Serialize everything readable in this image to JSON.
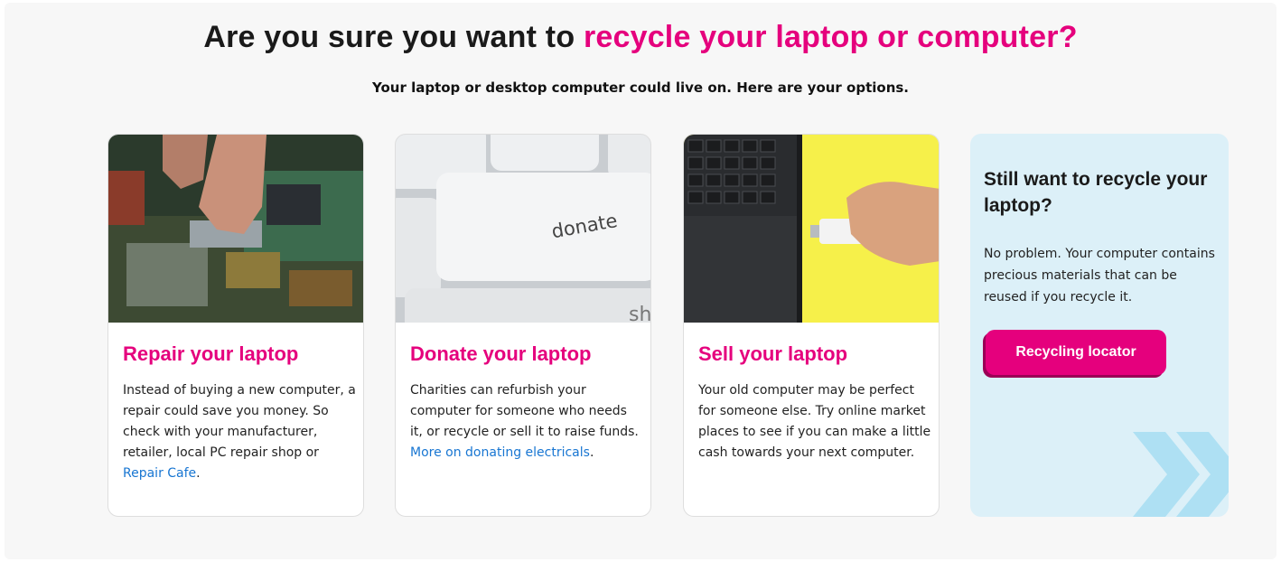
{
  "header": {
    "headline_plain": "Are you sure you want to ",
    "headline_accent": "recycle your laptop or computer?",
    "subheading": "Your laptop or desktop computer could live on. Here are your options."
  },
  "cards": [
    {
      "title": "Repair your laptop",
      "body": "Instead of buying a new computer, a repair could save you money. So check with your manufacturer, retailer, local PC repair shop or ",
      "link": "Repair Cafe",
      "suffix": ".",
      "image_icon": "laptop-repair-photo"
    },
    {
      "title": "Donate your laptop",
      "body": "Charities can refurbish your computer for someone who needs it, or recycle or sell it to raise funds. ",
      "link": "More on donating electricals",
      "suffix": ".",
      "image_icon": "donate-key-photo",
      "image_text": "donate",
      "image_text_2": "sh"
    },
    {
      "title": "Sell your laptop",
      "body": "Your old computer may be perfect for someone else. Try online market places to see if you can make a little cash towards your next computer.",
      "image_icon": "usb-laptop-photo"
    }
  ],
  "cta": {
    "title": "Still want to recycle your laptop?",
    "body": "No problem. Your computer contains precious materials that can be reused if you recycle it.",
    "button": "Recycling locator"
  },
  "colors": {
    "accent": "#e5007d",
    "link": "#1876d2",
    "cta_bg": "#dcf0f8",
    "chevron": "#aee0f3"
  }
}
